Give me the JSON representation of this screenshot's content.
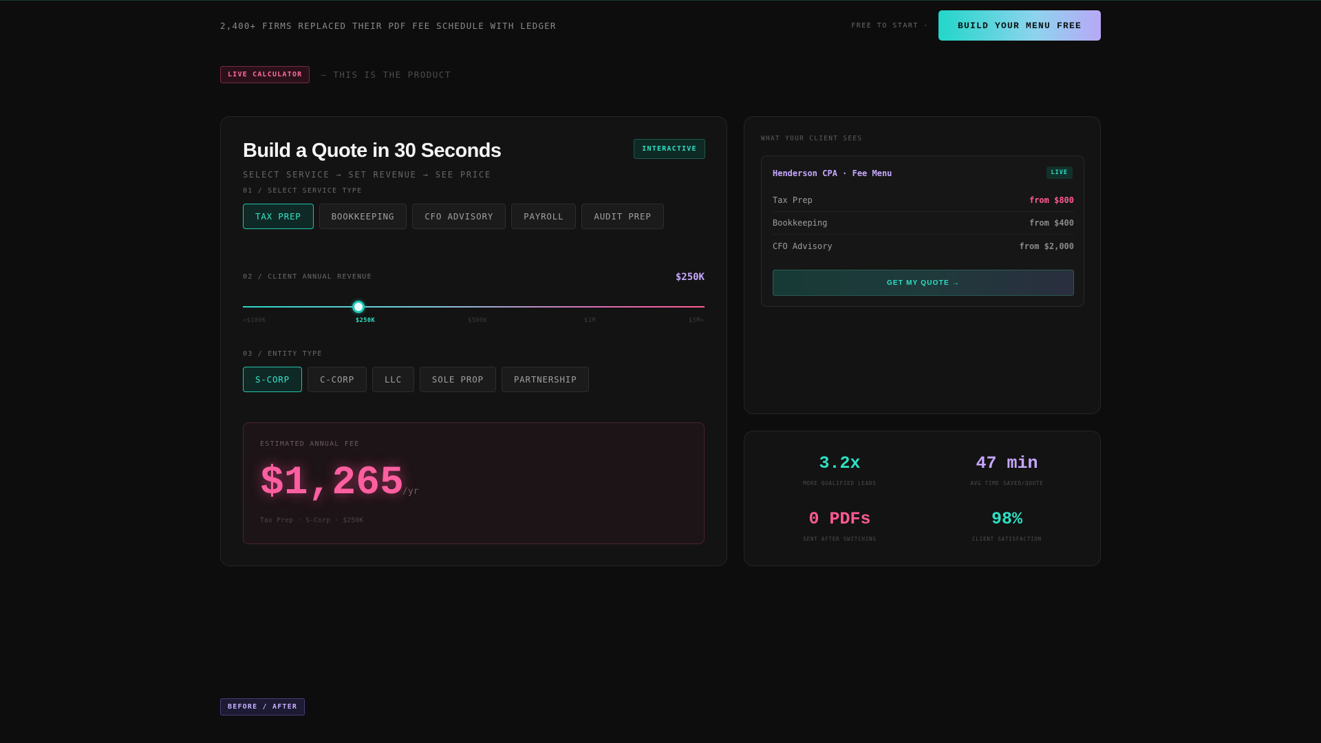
{
  "topbar": {
    "tagline": "2,400+ FIRMS REPLACED THEIR PDF FEE SCHEDULE WITH LEDGER",
    "free_text": "FREE TO START ·",
    "cta_label": "BUILD YOUR MENU FREE"
  },
  "section": {
    "badge": "LIVE CALCULATOR",
    "subtitle": "— THIS IS THE PRODUCT"
  },
  "calculator": {
    "title": "Build a Quote in 30 Seconds",
    "subtitle": "SELECT SERVICE → SET REVENUE → SEE PRICE",
    "badge": "INTERACTIVE",
    "step1_label": "01 / SELECT SERVICE TYPE",
    "services": [
      {
        "label": "TAX PREP",
        "active": true
      },
      {
        "label": "BOOKKEEPING",
        "active": false
      },
      {
        "label": "CFO ADVISORY",
        "active": false
      },
      {
        "label": "PAYROLL",
        "active": false
      },
      {
        "label": "AUDIT PREP",
        "active": false
      }
    ],
    "step2_label": "02 / CLIENT ANNUAL REVENUE",
    "revenue_value": "$250K",
    "slider_position": 0.25,
    "revenue_ticks": [
      "<$100K",
      "$250K",
      "$500K",
      "$1M",
      "$5M+"
    ],
    "active_tick": 1,
    "step3_label": "03 / ENTITY TYPE",
    "entities": [
      {
        "label": "S-CORP",
        "active": true
      },
      {
        "label": "C-CORP",
        "active": false
      },
      {
        "label": "LLC",
        "active": false
      },
      {
        "label": "SOLE PROP",
        "active": false
      },
      {
        "label": "PARTNERSHIP",
        "active": false
      }
    ],
    "fee_label": "ESTIMATED ANNUAL FEE",
    "fee_amount": "$1,265",
    "fee_unit": "/yr",
    "fee_detail": "Tax Prep · S-Corp · $250K"
  },
  "client_preview": {
    "label": "WHAT YOUR CLIENT SEES",
    "menu_title": "Henderson CPA · Fee Menu",
    "live_tag": "LIVE",
    "rows": [
      {
        "service": "Tax Prep",
        "price": "from $800",
        "highlight": true
      },
      {
        "service": "Bookkeeping",
        "price": "from $400",
        "highlight": false
      },
      {
        "service": "CFO Advisory",
        "price": "from $2,000",
        "highlight": false
      }
    ],
    "button_label": "GET MY QUOTE →"
  },
  "stats": [
    {
      "value": "3.2x",
      "label": "MORE QUALIFIED LEADS",
      "color": "#2ee0c4"
    },
    {
      "value": "47 min",
      "label": "AVG TIME SAVED/QUOTE",
      "color": "#c6a7ff"
    },
    {
      "value": "0 PDFs",
      "label": "SENT AFTER SWITCHING",
      "color": "#ff5a94"
    },
    {
      "value": "98%",
      "label": "CLIENT SATISFACTION",
      "color": "#2ee0c4"
    }
  ],
  "before_after_badge": "BEFORE / AFTER"
}
